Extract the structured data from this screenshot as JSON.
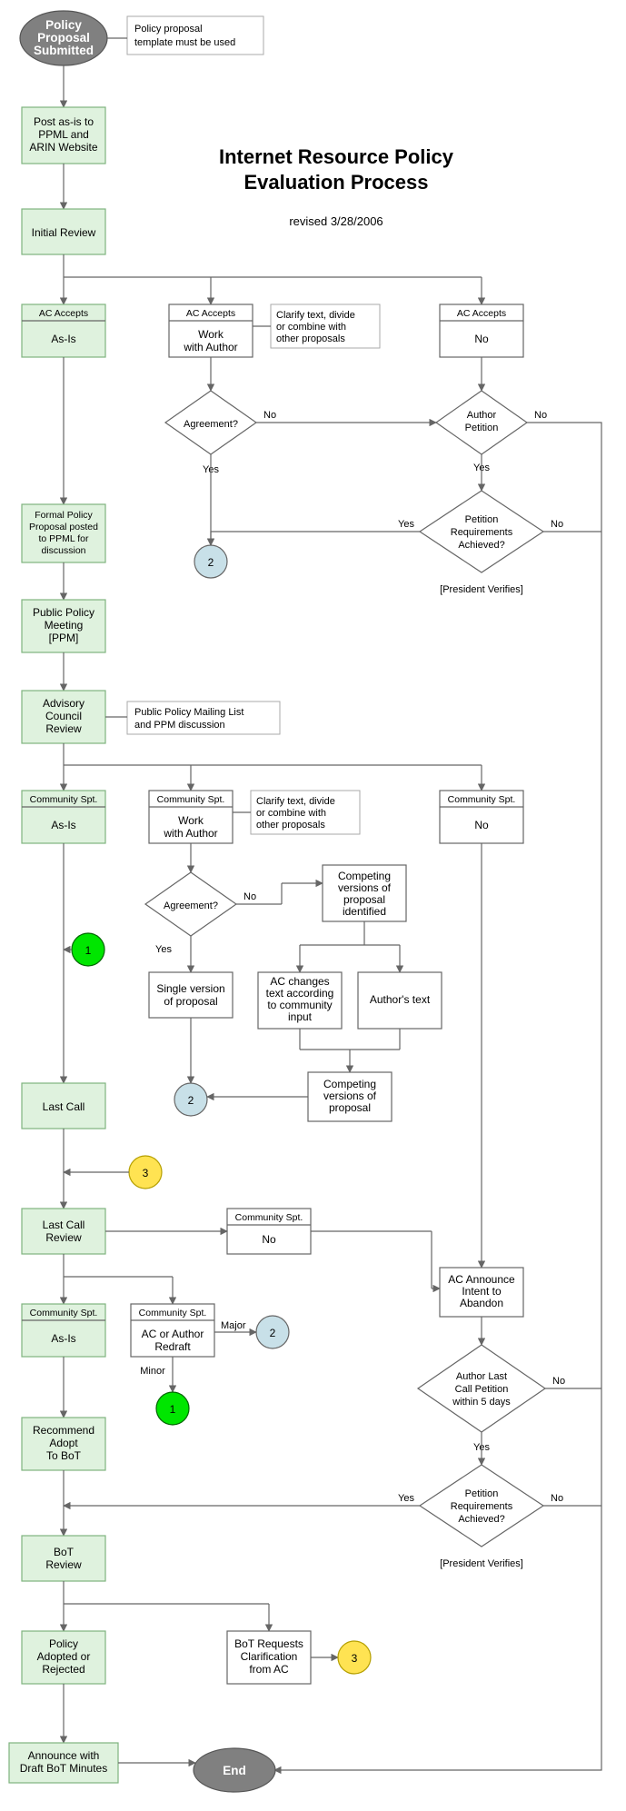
{
  "title1": "Internet Resource Policy",
  "title2": "Evaluation Process",
  "revised": "revised 3/28/2006",
  "start1": "Policy",
  "start2": "Proposal",
  "start3": "Submitted",
  "note_template1": "Policy proposal",
  "note_template2": "template must be used",
  "post1": "Post as-is to",
  "post2": "PPML and",
  "post3": "ARIN Website",
  "initrev": "Initial Review",
  "ac_accepts": "AC Accepts",
  "asis": "As-Is",
  "work1": "Work",
  "work2": "with Author",
  "acno": "No",
  "clarify1": "Clarify text, divide",
  "clarify2": "or combine with",
  "clarify3": "other proposals",
  "agreement": "Agreement?",
  "yes": "Yes",
  "no": "No",
  "authpet1": "Author",
  "authpet2": "Petition",
  "petreq1": "Petition",
  "petreq2": "Requirements",
  "petreq3": "Achieved?",
  "presver": "[President Verifies]",
  "formal1": "Formal Policy",
  "formal2": "Proposal posted",
  "formal3": "to PPML for",
  "formal4": "discussion",
  "ppm1": "Public Policy",
  "ppm2": "Meeting",
  "ppm3": "[PPM]",
  "acr1": "Advisory",
  "acr2": "Council",
  "acr3": "Review",
  "note_ppm1": "Public Policy Mailing List",
  "note_ppm2": "and PPM discussion",
  "comspt": "Community Spt.",
  "compver1": "Competing",
  "compver2": "versions of",
  "compver3": "proposal",
  "compver4": "identified",
  "single1": "Single version",
  "single2": "of proposal",
  "acchg1": "AC changes",
  "acchg2": "text according",
  "acchg3": "to community",
  "acchg4": "input",
  "authtxt": "Author's text",
  "compprop1": "Competing",
  "compprop2": "versions of",
  "compprop3": "proposal",
  "lastcall": "Last Call",
  "lcrev1": "Last Call",
  "lcrev2": "Review",
  "csno": "No",
  "acabandon1": "AC Announce",
  "acabandon2": "Intent to",
  "acabandon3": "Abandon",
  "redraft1": "AC or Author",
  "redraft2": "Redraft",
  "major": "Major",
  "minor": "Minor",
  "lcpet1": "Author Last",
  "lcpet2": "Call Petition",
  "lcpet3": "within 5 days",
  "recadopt1": "Recommend",
  "recadopt2": "Adopt",
  "recadopt3": "To BoT",
  "botrev1": "BoT",
  "botrev2": "Review",
  "adopted1": "Policy",
  "adopted2": "Adopted or",
  "adopted3": "Rejected",
  "botclar1": "BoT Requests",
  "botclar2": "Clarification",
  "botclar3": "from AC",
  "ann1": "Announce with",
  "ann2": "Draft BoT Minutes",
  "end": "End",
  "n1": "1",
  "n2": "2",
  "n3": "3"
}
